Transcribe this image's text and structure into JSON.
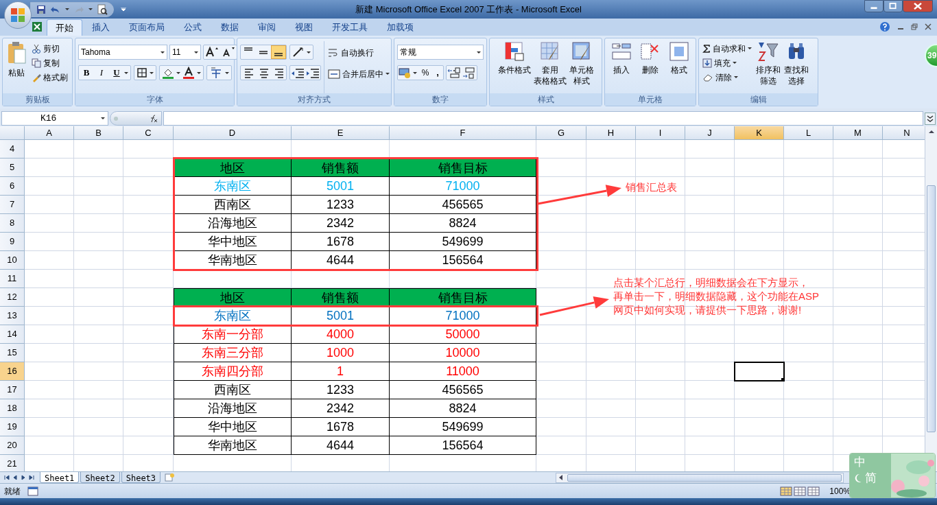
{
  "window": {
    "title": "新建 Microsoft Office Excel 2007 工作表 - Microsoft Excel"
  },
  "ribbon_tabs": [
    {
      "label": "开始",
      "selected": true
    },
    {
      "label": "插入",
      "selected": false
    },
    {
      "label": "页面布局",
      "selected": false
    },
    {
      "label": "公式",
      "selected": false
    },
    {
      "label": "数据",
      "selected": false
    },
    {
      "label": "审阅",
      "selected": false
    },
    {
      "label": "视图",
      "selected": false
    },
    {
      "label": "开发工具",
      "selected": false
    },
    {
      "label": "加载项",
      "selected": false
    }
  ],
  "clipboard": {
    "label": "剪贴板",
    "paste": "粘贴",
    "items": [
      "剪切",
      "复制",
      "格式刷"
    ]
  },
  "font": {
    "label": "字体",
    "family": "Tahoma",
    "size": "11",
    "bold": "B",
    "italic": "I",
    "underline": "U"
  },
  "alignment": {
    "label": "对齐方式",
    "valign": [
      {
        "selected": false
      },
      {
        "selected": false
      },
      {
        "selected": true
      }
    ],
    "wrap": "自动换行",
    "merge": "合并后居中"
  },
  "number": {
    "label": "数字",
    "format": "常规",
    "percent": "%",
    "comma": ","
  },
  "styles": {
    "label": "样式",
    "buttons": [
      [
        "条件格式"
      ],
      [
        "套用",
        "表格格式"
      ],
      [
        "单元格",
        "样式"
      ]
    ]
  },
  "cells": {
    "label": "单元格",
    "buttons": [
      [
        "插入"
      ],
      [
        "删除"
      ],
      [
        "格式"
      ]
    ]
  },
  "editing": {
    "label": "编辑",
    "items": [
      "自动求和",
      "填充",
      "清除"
    ],
    "buttons": [
      [
        "排序和",
        "筛选"
      ],
      [
        "查找和",
        "选择"
      ]
    ]
  },
  "badge": "39",
  "formula_bar": {
    "name_box": "K16"
  },
  "sheet": {
    "columns": [
      {
        "label": "A",
        "selected": false
      },
      {
        "label": "B",
        "selected": false
      },
      {
        "label": "C",
        "selected": false
      },
      {
        "label": "D",
        "selected": false
      },
      {
        "label": "E",
        "selected": false
      },
      {
        "label": "F",
        "selected": false
      },
      {
        "label": "G",
        "selected": false
      },
      {
        "label": "H",
        "selected": false
      },
      {
        "label": "I",
        "selected": false
      },
      {
        "label": "J",
        "selected": false
      },
      {
        "label": "K",
        "selected": true
      },
      {
        "label": "L",
        "selected": false
      },
      {
        "label": "M",
        "selected": false
      },
      {
        "label": "N",
        "selected": false
      }
    ],
    "rows": [
      {
        "number": "4",
        "selected": false,
        "kind": "empty",
        "outlined": false
      },
      {
        "number": "5",
        "selected": false,
        "kind": "header",
        "outlined": true,
        "cells": [
          "地区",
          "销售额",
          "销售目标"
        ]
      },
      {
        "number": "6",
        "selected": false,
        "kind": "summary",
        "outlined": true,
        "cells": [
          "东南区",
          "5001",
          "71000"
        ]
      },
      {
        "number": "7",
        "selected": false,
        "kind": "plain",
        "outlined": true,
        "cells": [
          "西南区",
          "1233",
          "456565"
        ]
      },
      {
        "number": "8",
        "selected": false,
        "kind": "plain",
        "outlined": true,
        "cells": [
          "沿海地区",
          "2342",
          "8824"
        ]
      },
      {
        "number": "9",
        "selected": false,
        "kind": "plain",
        "outlined": true,
        "cells": [
          "华中地区",
          "1678",
          "549699"
        ]
      },
      {
        "number": "10",
        "selected": false,
        "kind": "plain",
        "outlined": true,
        "cells": [
          "华南地区",
          "4644",
          "156564"
        ]
      },
      {
        "number": "11",
        "selected": false,
        "kind": "empty",
        "outlined": false
      },
      {
        "number": "12",
        "selected": false,
        "kind": "header",
        "outlined": false,
        "cells": [
          "地区",
          "销售额",
          "销售目标"
        ]
      },
      {
        "number": "13",
        "selected": false,
        "kind": "focus",
        "outlined": true,
        "cells": [
          "东南区",
          "5001",
          "71000"
        ]
      },
      {
        "number": "14",
        "selected": false,
        "kind": "detail",
        "outlined": false,
        "cells": [
          "东南一分部",
          "4000",
          "50000"
        ]
      },
      {
        "number": "15",
        "selected": false,
        "kind": "detail",
        "outlined": false,
        "cells": [
          "东南三分部",
          "1000",
          "10000"
        ]
      },
      {
        "number": "16",
        "selected": true,
        "kind": "detail",
        "outlined": false,
        "cells": [
          "东南四分部",
          "1",
          "11000"
        ]
      },
      {
        "number": "17",
        "selected": false,
        "kind": "plain",
        "outlined": false,
        "cells": [
          "西南区",
          "1233",
          "456565"
        ]
      },
      {
        "number": "18",
        "selected": false,
        "kind": "plain",
        "outlined": false,
        "cells": [
          "沿海地区",
          "2342",
          "8824"
        ]
      },
      {
        "number": "19",
        "selected": false,
        "kind": "plain",
        "outlined": false,
        "cells": [
          "华中地区",
          "1678",
          "549699"
        ]
      },
      {
        "number": "20",
        "selected": false,
        "kind": "plain",
        "outlined": false,
        "cells": [
          "华南地区",
          "4644",
          "156564"
        ]
      },
      {
        "number": "21",
        "selected": false,
        "kind": "empty",
        "outlined": false
      }
    ]
  },
  "annotations": [
    {
      "lines": [
        "销售汇总表"
      ]
    },
    {
      "lines": [
        "点击某个汇总行，明细数据会在下方显示，",
        "再单击一下，明细数据隐藏，这个功能在ASP",
        "网页中如何实现，请提供一下思路，谢谢!"
      ]
    }
  ],
  "sheet_tabs": [
    {
      "label": "Sheet1",
      "selected": true
    },
    {
      "label": "Sheet2",
      "selected": false
    },
    {
      "label": "Sheet3",
      "selected": false
    }
  ],
  "status_bar": {
    "mode": "就绪",
    "zoom": "100%"
  },
  "ime": {
    "chars": [
      "中",
      "简"
    ]
  }
}
